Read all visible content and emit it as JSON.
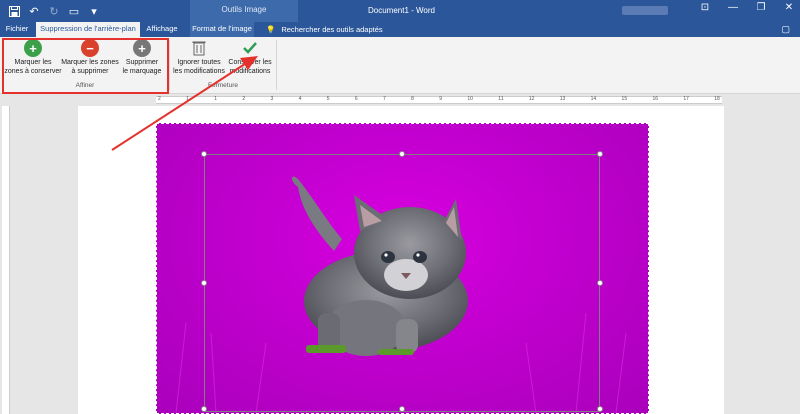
{
  "titlebar": {
    "context_tab_group": "Outils Image",
    "document_title": "Document1 - Word",
    "qat_icons": [
      "save-icon",
      "undo-icon",
      "redo-icon",
      "touch-mode-icon",
      "customize-icon"
    ],
    "window_controls": [
      "ribbon-display-icon",
      "minimize-icon",
      "restore-icon",
      "close-icon"
    ]
  },
  "tabs": {
    "file": "Fichier",
    "background_removal": "Suppression de l'arrière-plan",
    "view": "Affichage",
    "picture_format": "Format de l'image",
    "search_hint": "Rechercher des outils adaptés"
  },
  "ribbon": {
    "refine_group": {
      "label": "Affiner",
      "mark_keep": "Marquer les\nzones à conserver",
      "mark_remove": "Marquer les zones\nà supprimer",
      "delete_mark": "Supprimer\nle marquage"
    },
    "close_group": {
      "label": "Fermeture",
      "discard": "Ignorer toutes\nles modifications",
      "keep": "Conserver les\nmodifications"
    }
  },
  "ruler": {
    "numbers": [
      "2",
      "1",
      "1",
      "2",
      "3",
      "4",
      "5",
      "6",
      "7",
      "8",
      "9",
      "10",
      "11",
      "12",
      "13",
      "14",
      "15",
      "16",
      "17",
      "18"
    ]
  },
  "colors": {
    "word_blue": "#2b579a",
    "context_blue": "#3d6aab",
    "annotation_red": "#e5312c",
    "removal_magenta": "#c300d0",
    "keep_green": "#3c9f4a",
    "remove_red": "#d9412c"
  }
}
